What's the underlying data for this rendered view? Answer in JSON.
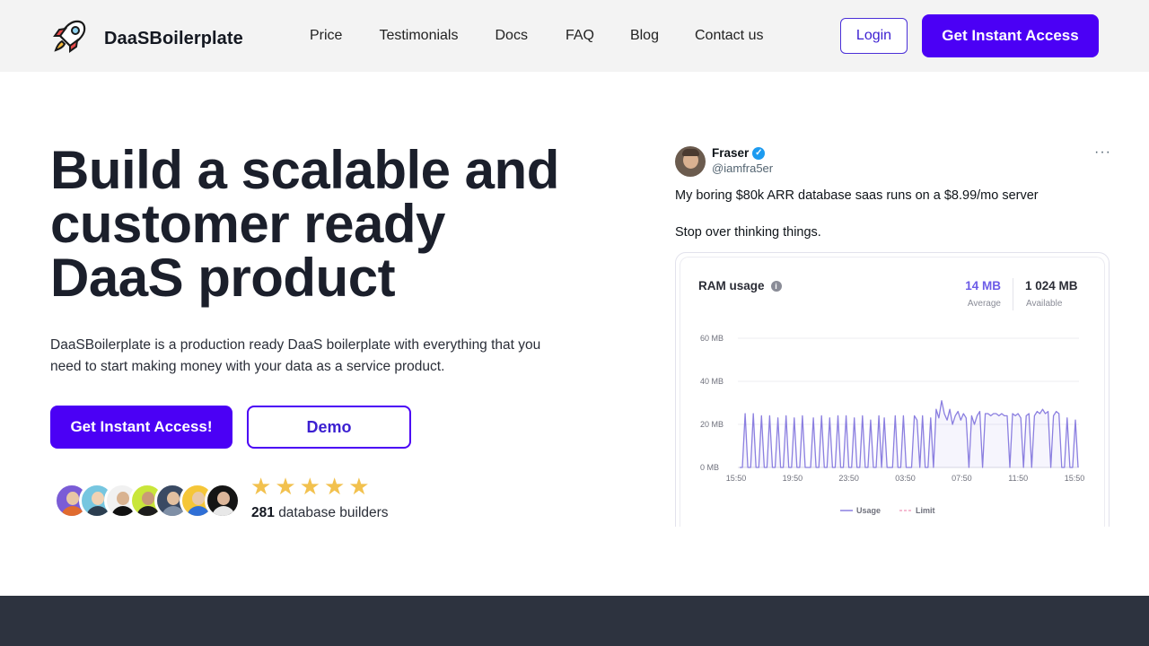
{
  "header": {
    "brand": "DaaSBoilerplate",
    "nav": [
      "Price",
      "Testimonials",
      "Docs",
      "FAQ",
      "Blog",
      "Contact us"
    ],
    "login_label": "Login",
    "access_label": "Get Instant Access"
  },
  "hero": {
    "title_line1": "Build a scalable and",
    "title_line2": "customer ready",
    "title_line3": "DaaS product",
    "description": "DaaSBoilerplate is a production ready DaaS boilerplate with everything that you need to start making money with your data as a service product.",
    "cta_label": "Get Instant Access!",
    "demo_label": "Demo",
    "rating_stars": 5,
    "builders_count": "281",
    "builders_label": "database builders"
  },
  "tweet": {
    "name": "Fraser",
    "handle": "@iamfra5er",
    "more": "···",
    "text_line1": "My boring $80k ARR database saas runs on a $8.99/mo server",
    "text_line2": "Stop over thinking things."
  },
  "ram_card": {
    "title": "RAM usage",
    "info_icon": "i",
    "average_value": "14 MB",
    "average_label": "Average",
    "available_value": "1 024 MB",
    "available_label": "Available"
  },
  "chart_data": {
    "type": "line",
    "y_ticks": [
      "60 MB",
      "40 MB",
      "20 MB",
      "0 MB"
    ],
    "y_tick_values": [
      60,
      40,
      20,
      0
    ],
    "ylim": [
      0,
      60
    ],
    "x_ticks": [
      "15:50",
      "19:50",
      "23:50",
      "03:50",
      "07:50",
      "11:50",
      "15:50"
    ],
    "grid": true,
    "legend_position": "bottom",
    "series": [
      {
        "name": "Usage",
        "color": "#8b7fe0",
        "values": [
          0,
          0,
          25,
          0,
          0,
          25,
          0,
          0,
          24,
          0,
          0,
          24,
          0,
          0,
          23,
          0,
          0,
          24,
          0,
          0,
          23,
          0,
          0,
          24,
          0,
          0,
          0,
          23,
          0,
          0,
          24,
          0,
          0,
          23,
          0,
          0,
          24,
          0,
          0,
          24,
          0,
          0,
          23,
          0,
          0,
          24,
          0,
          0,
          22,
          0,
          0,
          24,
          0,
          23,
          0,
          0,
          0,
          24,
          0,
          0,
          24,
          0,
          0,
          0,
          24,
          22,
          0,
          24,
          0,
          0,
          23,
          0,
          27,
          23,
          31,
          25,
          22,
          27,
          20,
          24,
          26,
          22,
          25,
          23,
          0,
          24,
          20,
          24,
          26,
          0,
          25,
          25,
          24,
          25,
          25,
          24,
          25,
          24,
          24,
          0,
          25,
          24,
          25,
          23,
          0,
          24,
          25,
          0,
          24,
          26,
          25,
          27,
          25,
          26,
          0,
          24,
          26,
          25,
          0,
          0,
          23,
          0,
          0,
          22,
          0
        ]
      },
      {
        "name": "Limit",
        "color": "#f2a6c4",
        "values": []
      }
    ]
  },
  "colors": {
    "accent": "#4b00f5",
    "header_bg": "#f3f3f3",
    "footer_bg": "#2d333f",
    "star": "#f2c14e"
  }
}
